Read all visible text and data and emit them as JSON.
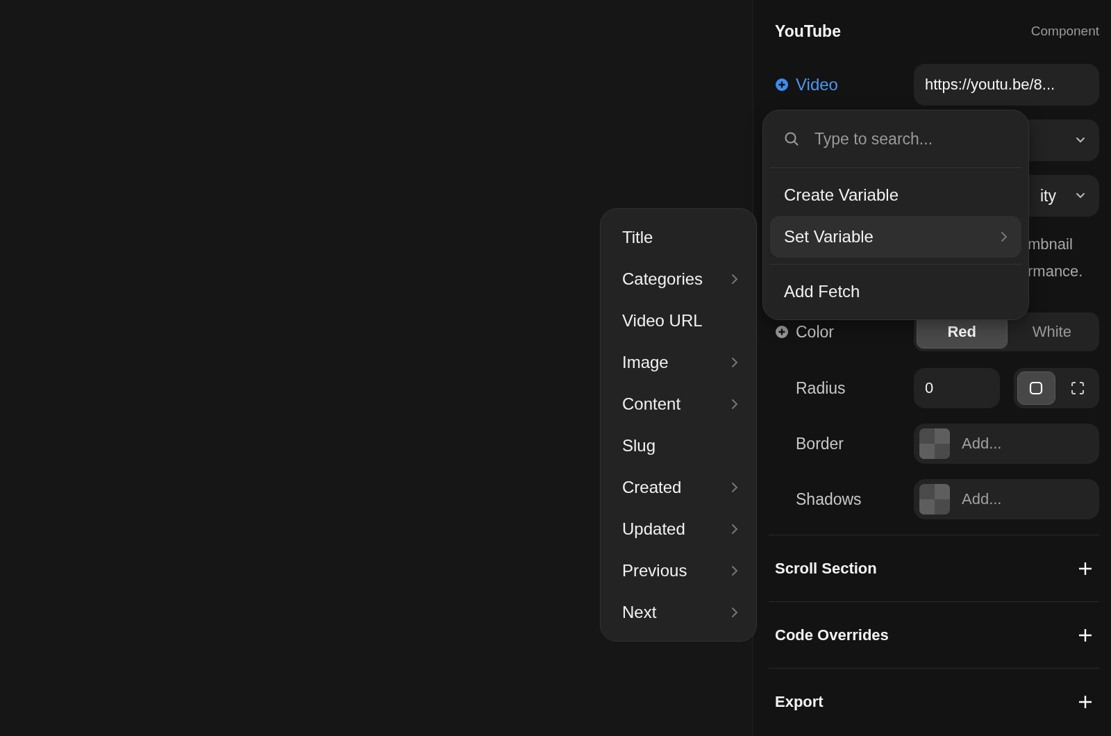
{
  "field_menu": {
    "items": [
      {
        "label": "Title",
        "submenu": false
      },
      {
        "label": "Categories",
        "submenu": true
      },
      {
        "label": "Video URL",
        "submenu": false
      },
      {
        "label": "Image",
        "submenu": true
      },
      {
        "label": "Content",
        "submenu": true
      },
      {
        "label": "Slug",
        "submenu": false
      },
      {
        "label": "Created",
        "submenu": true
      },
      {
        "label": "Updated",
        "submenu": true
      },
      {
        "label": "Previous",
        "submenu": true
      },
      {
        "label": "Next",
        "submenu": true
      }
    ]
  },
  "variable_menu": {
    "search": {
      "placeholder": "Type to search..."
    },
    "groups": [
      [
        {
          "label": "Create Variable",
          "submenu": false,
          "selected": false
        },
        {
          "label": "Set Variable",
          "submenu": true,
          "selected": true
        }
      ],
      [
        {
          "label": "Add Fetch",
          "submenu": false,
          "selected": false
        }
      ]
    ]
  },
  "panel": {
    "title": "YouTube",
    "subtitle": "Component",
    "properties": [
      {
        "kind": "text",
        "label": "Video",
        "add_icon": true,
        "linked": true,
        "value": "https://youtu.be/8..."
      },
      {
        "kind": "dropdown"
      },
      {
        "kind": "dropdown",
        "value": "ity"
      },
      {
        "kind": "note",
        "lines": [
          "mbnail",
          "rmance."
        ]
      },
      {
        "kind": "segmented",
        "label": "Color",
        "add_icon": true,
        "linked": false,
        "options": [
          {
            "label": "Red",
            "selected": true
          },
          {
            "label": "White",
            "selected": false
          }
        ]
      },
      {
        "kind": "radius",
        "label": "Radius",
        "value": "0",
        "modes": [
          {
            "kind": "uniform",
            "selected": true
          },
          {
            "kind": "individual",
            "selected": false
          }
        ]
      },
      {
        "kind": "fill",
        "label": "Border",
        "placeholder": "Add..."
      },
      {
        "kind": "fill",
        "label": "Shadows",
        "placeholder": "Add..."
      }
    ],
    "sections": [
      "Scroll Section",
      "Code Overrides",
      "Export"
    ]
  }
}
